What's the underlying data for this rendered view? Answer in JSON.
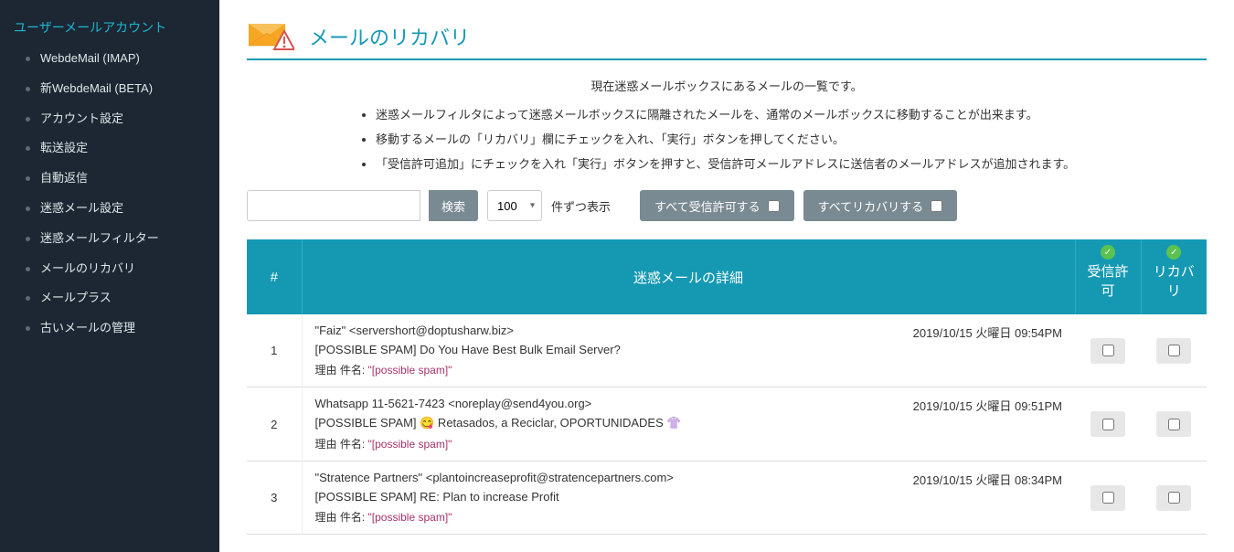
{
  "sidebar": {
    "header": "ユーザーメールアカウント",
    "items": [
      {
        "label": "WebdeMail (IMAP)"
      },
      {
        "label": "新WebdeMail (BETA)"
      },
      {
        "label": "アカウント設定"
      },
      {
        "label": "転送設定"
      },
      {
        "label": "自動返信"
      },
      {
        "label": "迷惑メール設定"
      },
      {
        "label": "迷惑メールフィルター"
      },
      {
        "label": "メールのリカバリ"
      },
      {
        "label": "メールプラス"
      },
      {
        "label": "古いメールの管理"
      }
    ]
  },
  "page": {
    "title": "メールのリカバリ",
    "intro": "現在迷惑メールボックスにあるメールの一覧です。",
    "bullets": [
      "迷惑メールフィルタによって迷惑メールボックスに隔離されたメールを、通常のメールボックスに移動することが出来ます。",
      "移動するメールの「リカバリ」欄にチェックを入れ、「実行」ボタンを押してください。",
      "「受信許可追加」にチェックを入れ「実行」ボタンを押すと、受信許可メールアドレスに送信者のメールアドレスが追加されます。"
    ]
  },
  "toolbar": {
    "search_label": "検索",
    "per_value": "100",
    "per_suffix": "件ずつ表示",
    "allow_all": "すべて受信許可する",
    "recover_all": "すべてリカバリする"
  },
  "table": {
    "head_num": "#",
    "head_detail": "迷惑メールの詳細",
    "head_allow": "受信許可",
    "head_recover": "リカバリ",
    "reason_prefix": "理由 件名: ",
    "rows": [
      {
        "num": "1",
        "from": "\"Faiz\" <servershort@doptusharw.biz>",
        "date": "2019/10/15 火曜日 09:54PM",
        "subject": "[POSSIBLE SPAM] Do You Have Best Bulk Email Server?",
        "reason": "\"[possible spam]\""
      },
      {
        "num": "2",
        "from": "Whatsapp 11-5621-7423 <noreplay@send4you.org>",
        "date": "2019/10/15 火曜日 09:51PM",
        "subject": "[POSSIBLE SPAM] 😋 Retasados, a Reciclar, OPORTUNIDADES 👚",
        "reason": "\"[possible spam]\""
      },
      {
        "num": "3",
        "from": "\"Stratence Partners\" <plantoincreaseprofit@stratencepartners.com>",
        "date": "2019/10/15 火曜日 08:34PM",
        "subject": "[POSSIBLE SPAM] RE: Plan to increase Profit",
        "reason": "\"[possible spam]\""
      }
    ]
  }
}
